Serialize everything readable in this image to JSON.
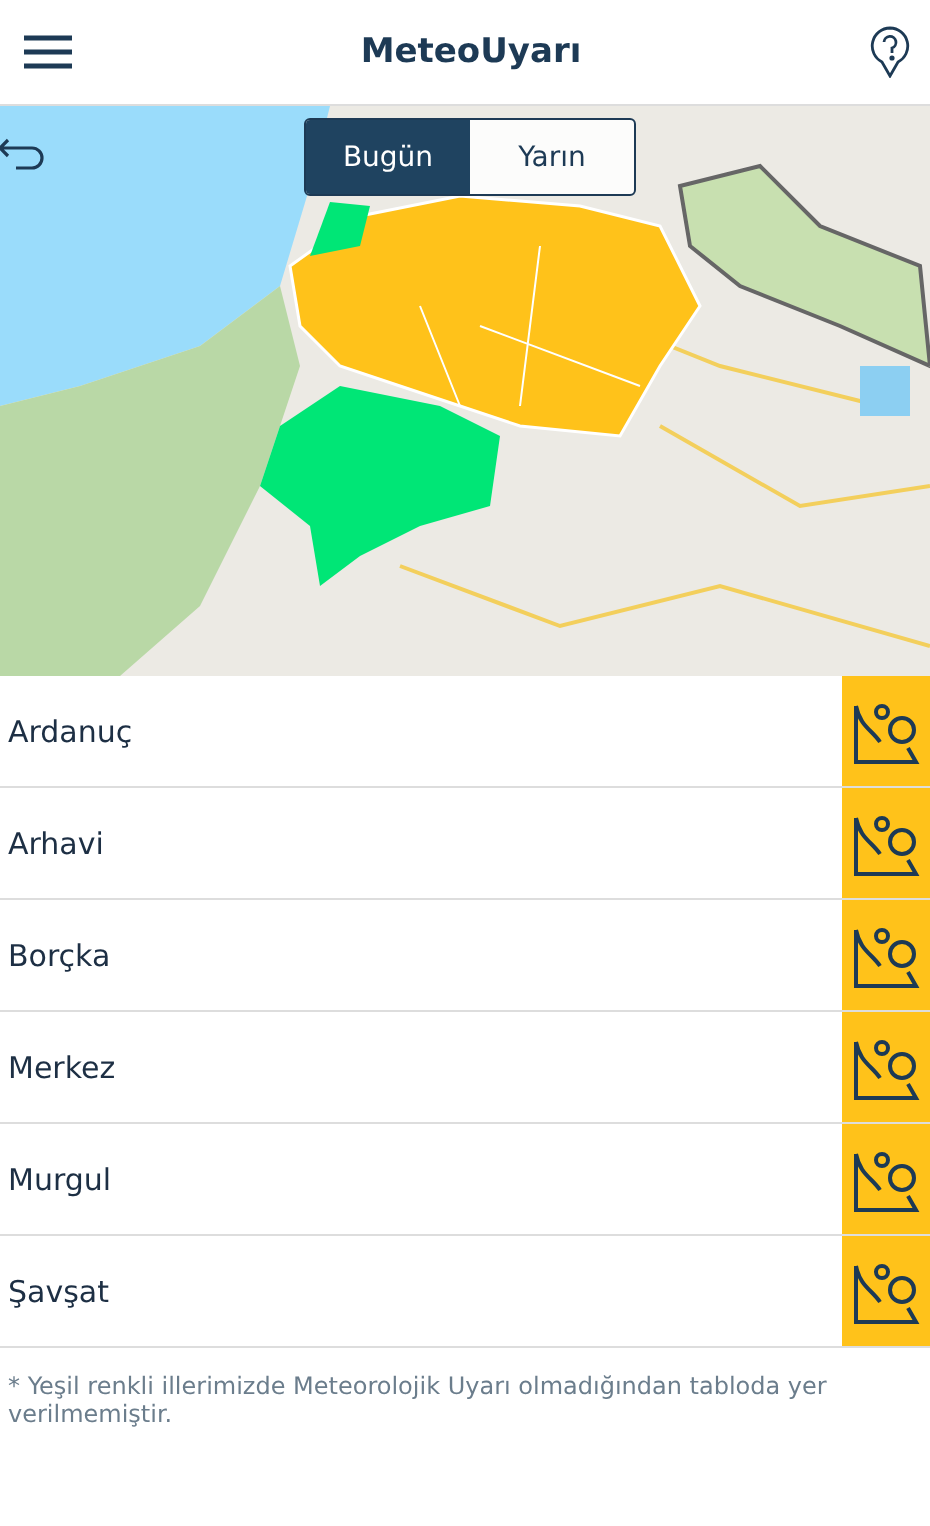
{
  "header": {
    "title": "MeteoUyarı"
  },
  "map": {
    "kind": "picture",
    "day_tabs": [
      {
        "label": "Bugün",
        "selected": true
      },
      {
        "label": "Yarın",
        "selected": false
      }
    ]
  },
  "districts": [
    {
      "name": "Ardanuç",
      "color": "#ffc21a"
    },
    {
      "name": "Arhavi",
      "color": "#ffc21a"
    },
    {
      "name": "Borçka",
      "color": "#ffc21a"
    },
    {
      "name": "Merkez",
      "color": "#ffc21a"
    },
    {
      "name": "Murgul",
      "color": "#ffc21a"
    },
    {
      "name": "Şavşat",
      "color": "#ffc21a"
    }
  ],
  "footnote": "* Yeşil renkli illerimizde Meteorolojik Uyarı olmadığından tabloda yer verilmemiştir."
}
